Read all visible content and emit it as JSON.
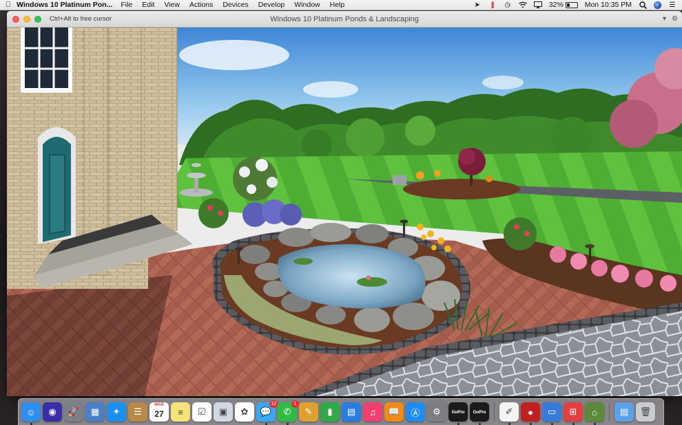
{
  "menubar": {
    "app_name": "Windows 10 Platinum Pon...",
    "items": [
      "File",
      "Edit",
      "View",
      "Actions",
      "Devices",
      "Develop",
      "Window",
      "Help"
    ],
    "battery_percent": "32%",
    "battery_level": 0.32,
    "clock": "Mon 10:35 PM"
  },
  "window": {
    "title": "Windows 10 Platinum Ponds & Landscaping",
    "hint": "Ctrl+Alt to free cursor"
  },
  "dock": {
    "items": [
      {
        "name": "finder",
        "color": "#2f8ff0",
        "glyph": "☺"
      },
      {
        "name": "siri",
        "color": "#3a2ea8",
        "glyph": "◉"
      },
      {
        "name": "launchpad",
        "color": "#7a7f88",
        "glyph": "🚀"
      },
      {
        "name": "photo-app",
        "color": "#4a80c8",
        "glyph": "▦"
      },
      {
        "name": "safari",
        "color": "#1c8ef0",
        "glyph": "✦"
      },
      {
        "name": "contacts",
        "color": "#b88a4a",
        "glyph": "☰"
      },
      {
        "name": "calendar",
        "color": "#ffffff",
        "glyph": ""
      },
      {
        "name": "notes",
        "color": "#f7e27a",
        "glyph": "≡"
      },
      {
        "name": "reminders",
        "color": "#ffffff",
        "glyph": "☑"
      },
      {
        "name": "preview",
        "color": "#d0d8e4",
        "glyph": "▣"
      },
      {
        "name": "photos",
        "color": "#ffffff",
        "glyph": "✿"
      },
      {
        "name": "messages",
        "color": "#3aa8f0",
        "glyph": "💬"
      },
      {
        "name": "facetime",
        "color": "#2dbd45",
        "glyph": "✆"
      },
      {
        "name": "keynote-app",
        "color": "#e0a030",
        "glyph": "✎"
      },
      {
        "name": "numbers",
        "color": "#2eaa48",
        "glyph": "▮"
      },
      {
        "name": "keynote",
        "color": "#2a7de0",
        "glyph": "▤"
      },
      {
        "name": "itunes",
        "color": "#f14070",
        "glyph": "♫"
      },
      {
        "name": "ibooks",
        "color": "#f08a18",
        "glyph": "📖"
      },
      {
        "name": "app-store",
        "color": "#1d8bf0",
        "glyph": "Ⓐ"
      },
      {
        "name": "system-preferences",
        "color": "#7d7d82",
        "glyph": "⚙"
      },
      {
        "name": "gopro-1",
        "color": "#1a1a1a",
        "glyph": "GoPro"
      },
      {
        "name": "gopro-2",
        "color": "#1a1a1a",
        "glyph": "GoPro"
      },
      {
        "name": "separator"
      },
      {
        "name": "app-pencil",
        "color": "#f4f4f4",
        "glyph": "✐"
      },
      {
        "name": "app-circle",
        "color": "#c02020",
        "glyph": "●"
      },
      {
        "name": "parallels-vm",
        "color": "#3a7ad8",
        "glyph": "▭"
      },
      {
        "name": "windows-app",
        "color": "#e04040",
        "glyph": "⊞"
      },
      {
        "name": "landscape-app",
        "color": "#5a8a3a",
        "glyph": "⌂"
      },
      {
        "name": "separator"
      },
      {
        "name": "downloads-folder",
        "color": "#5aa2e8",
        "glyph": "▤"
      },
      {
        "name": "trash",
        "color": "#c8ccd2",
        "glyph": "🗑"
      }
    ],
    "calendar_month": "MAR",
    "calendar_day": "27",
    "badges": {
      "messages": "12",
      "facetime": "1"
    }
  }
}
